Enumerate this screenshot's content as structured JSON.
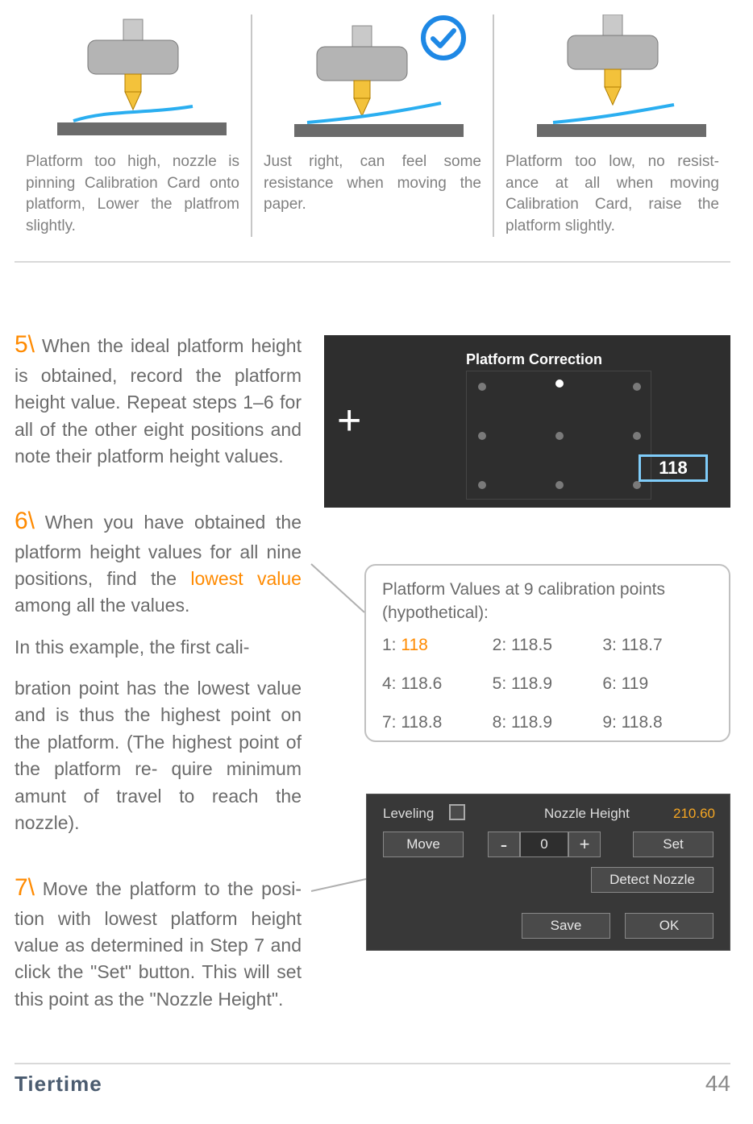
{
  "top": {
    "col1": {
      "caption": "Platform too high, nozzle is pinning Calibration Card onto platform, Lower the platfrom slightly."
    },
    "col2": {
      "caption": "Just right, can feel some resistance when moving the paper."
    },
    "col3": {
      "caption": "Platform too low, no resist-ance at all when moving Calibration Card, raise the platform slightly."
    }
  },
  "steps": {
    "s5": {
      "num": "5\\",
      "text": " When the ideal platform height is obtained, record the platform height value. Repeat steps 1–6 for all of the other eight positions and note their platform height values."
    },
    "s6": {
      "num": "6\\",
      "text_a": " When you have obtained the platform height values for all nine positions, find the ",
      "lowest": "lowest value",
      "text_b": " among all the values.",
      "para2": "In this example, the first cali-",
      "para3": "bration point has the lowest value and is thus the highest point on the platform. (The highest point of the platform re- quire minimum amunt of travel to reach the nozzle)."
    },
    "s7": {
      "num": "7\\",
      "text": " Move the platform to the posi-tion with lowest platform height value as determined in Step 7 and click the \"Set\" button. This will set this point as the \"Nozzle Height\"."
    }
  },
  "shot1": {
    "title": "Platform Correction",
    "value": "118"
  },
  "values_table": {
    "title": "Platform Values at 9 calibration points (hypothetical):",
    "cells": {
      "c1l": "1: ",
      "c1v": "118",
      "c2": "2: 118.5",
      "c3": "3: 118.7",
      "c4": "4: 118.6",
      "c5": "5: 118.9",
      "c6": "6: 119",
      "c7": "7: 118.8",
      "c8": "8: 118.9",
      "c9": "9: 118.8"
    }
  },
  "shot2": {
    "leveling": "Leveling",
    "nh_label": "Nozzle Height",
    "nh_value": "210.60",
    "move": "Move",
    "minus": "-",
    "zero": "0",
    "plus": "+",
    "set": "Set",
    "detect": "Detect Nozzle",
    "save": "Save",
    "ok": "OK"
  },
  "footer": {
    "brand": "Tiertime",
    "page": "44"
  }
}
